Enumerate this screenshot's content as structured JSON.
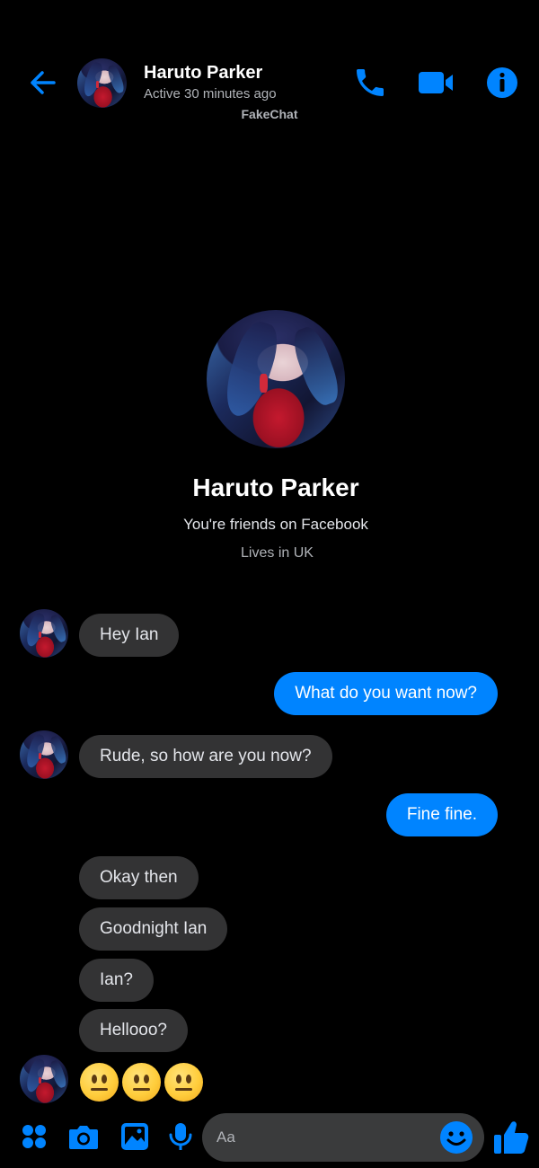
{
  "accent_color": "#0084ff",
  "header": {
    "contact_name": "Haruto Parker",
    "status": "Active 30 minutes ago",
    "watermark": "FakeChat",
    "icons": [
      "back-arrow-icon",
      "phone-icon",
      "video-camera-icon",
      "info-icon"
    ]
  },
  "profile": {
    "name": "Haruto Parker",
    "friends_note": "You're friends on Facebook",
    "location": "Lives in UK"
  },
  "messages": [
    {
      "from": "them",
      "text": "Hey Ian"
    },
    {
      "from": "me",
      "text": "What do you want now?"
    },
    {
      "from": "them",
      "text": "Rude, so how are you now?"
    },
    {
      "from": "me",
      "text": "Fine fine."
    },
    {
      "from": "them",
      "text": "Okay then"
    },
    {
      "from": "them",
      "text": "Goodnight Ian"
    },
    {
      "from": "them",
      "text": "Ian?"
    },
    {
      "from": "them",
      "text": "Hellooo?"
    },
    {
      "from": "them",
      "text": "😐😐😐"
    }
  ],
  "composer": {
    "placeholder": "Aa",
    "icons": [
      "apps-grid-icon",
      "camera-icon",
      "gallery-icon",
      "microphone-icon",
      "emoji-icon",
      "thumbs-up-icon"
    ]
  }
}
